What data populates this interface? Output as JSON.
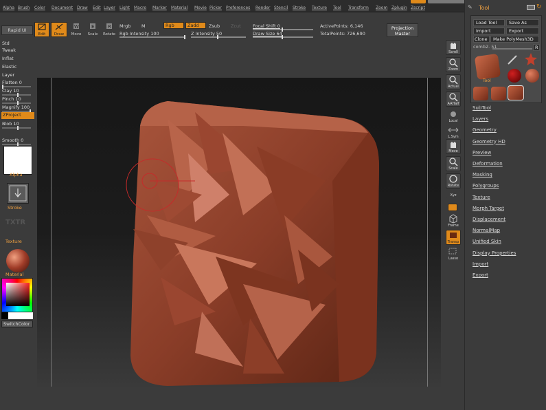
{
  "menu": {
    "items": [
      "Alpha",
      "Brush",
      "Color",
      "Document",
      "Draw",
      "Edit",
      "Layer",
      "Light",
      "Macro",
      "Marker",
      "Material",
      "Movie",
      "Picker",
      "Preferences",
      "Render",
      "Stencil",
      "Stroke",
      "Texture",
      "Tool",
      "Transform",
      "Zoom",
      "Zplugin",
      "Zscript"
    ]
  },
  "topbar": {
    "projection_master": "Projection Master",
    "edit": "Edit",
    "draw": "Draw",
    "move": "Move",
    "scale": "Scale",
    "rotate": "Rotate",
    "mrgb": "Mrgb",
    "m": "M",
    "rgb_toggle": "Rgb",
    "zadd": "Zadd",
    "zsub": "Zsub",
    "zcut": "Zcut",
    "rgb_intensity_label": "Rgb Intensity",
    "rgb_intensity_value": "100",
    "z_intensity_label": "Z Intensity",
    "z_intensity_value": "50",
    "focal_shift_label": "Focal Shift",
    "focal_shift_value": "0",
    "draw_size_label": "Draw Size",
    "draw_size_value": "64",
    "active_points": "ActivePoints: 6,146",
    "total_points": "TotalPoints: 726,690",
    "rgb_intensity_fraction": 1.0,
    "z_intensity_fraction": 0.5,
    "focal_shift_fraction": 0.5,
    "draw_size_fraction": 0.5
  },
  "left": {
    "rapid": "Rapid UI",
    "brushes": [
      "Std",
      "Tweak",
      "Inflat",
      "Elastic",
      "Layer"
    ],
    "flatten": "Flatten 0",
    "clay": "Clay 10",
    "pinch": "Pinch 10",
    "magnify": "Magnify 100",
    "zproject": "ZProject",
    "blob": "Blob 10",
    "smooth": "Smooth 0",
    "alpha_label": "Alpha",
    "stroke_label": "Stroke",
    "texture_label": "Texture",
    "texture_logo": "TXTR",
    "material_label": "Material",
    "switch_color": "SwitchColor"
  },
  "shelf": {
    "scroll": "Scroll",
    "zoom": "Zoom",
    "actual": "Actual",
    "aahalf": "AAHalf",
    "local": "Local",
    "lsym": "L.Sym",
    "move": "Move",
    "scale": "Scale",
    "rotate": "Rotate",
    "xyz": "Xyz",
    "frame": "Frame",
    "transp": "Transp",
    "lasso": "Lasso"
  },
  "tool": {
    "title": "Tool",
    "saveas": "Save As",
    "load": "Load Tool",
    "import": "Import",
    "export": "Export",
    "clone": "Clone",
    "make_polymesh": "Make PolyMesh3D",
    "current": "comb2. 51",
    "r_button": "R",
    "thumbs_label": "Tool",
    "menu": [
      "SubTool",
      "Layers",
      "Geometry",
      "Geometry HD",
      "Preview",
      "Deformation",
      "Masking",
      "Polygroups",
      "Texture",
      "Morph Target",
      "Displacement",
      "NormalMap",
      "Unified Skin",
      "Display Properties",
      "Import",
      "Export"
    ]
  },
  "colors": {
    "accent": "#e08a1a",
    "mesh": "#8a3d28"
  }
}
